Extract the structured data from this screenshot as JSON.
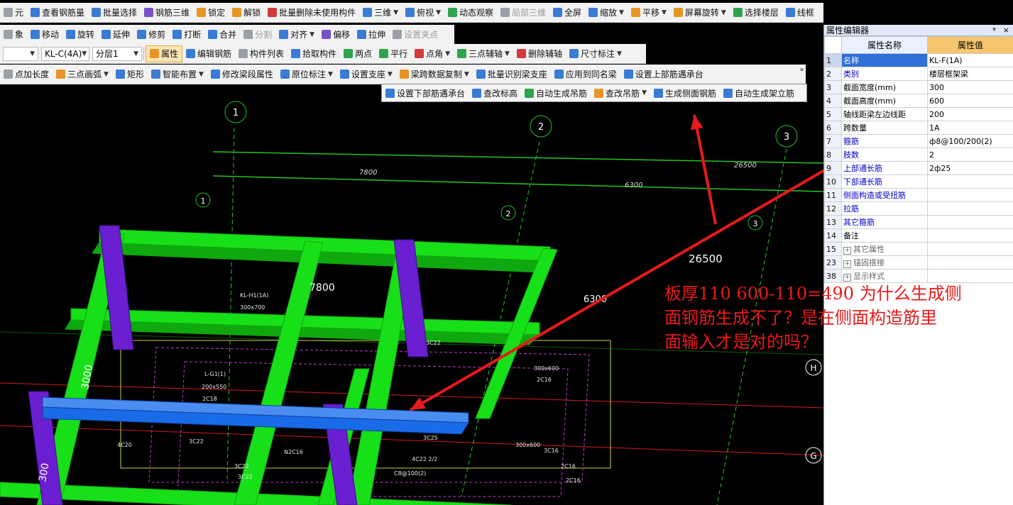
{
  "toolbar1": [
    {
      "label": "元",
      "icon": "gray"
    },
    {
      "label": "查看钢筋量",
      "icon": "blue"
    },
    {
      "label": "批量选择",
      "icon": "blue"
    },
    {
      "label": "钢筋三维",
      "icon": "purple"
    },
    {
      "label": "锁定",
      "icon": "orange"
    },
    {
      "label": "解锁",
      "icon": "orange"
    },
    {
      "label": "批量删除未使用构件",
      "icon": "red"
    },
    {
      "label": "三维",
      "icon": "blue",
      "caret": true
    },
    {
      "label": "俯视",
      "icon": "blue",
      "caret": true
    },
    {
      "label": "动态观察",
      "icon": "green"
    },
    {
      "label": "局部三维",
      "icon": "gray",
      "disabled": true
    },
    {
      "label": "全屏",
      "icon": "blue"
    },
    {
      "label": "缩放",
      "icon": "blue",
      "caret": true
    },
    {
      "label": "平移",
      "icon": "orange",
      "caret": true
    },
    {
      "label": "屏幕旋转",
      "icon": "orange",
      "caret": true
    },
    {
      "label": "选择楼层",
      "icon": "green"
    },
    {
      "label": "线框",
      "icon": "blue"
    }
  ],
  "toolbar2": [
    {
      "label": "象",
      "icon": "gray"
    },
    {
      "label": "移动",
      "icon": "blue"
    },
    {
      "label": "旋转",
      "icon": "blue"
    },
    {
      "label": "延伸",
      "icon": "blue"
    },
    {
      "label": "修剪",
      "icon": "blue"
    },
    {
      "label": "打断",
      "icon": "blue"
    },
    {
      "label": "合并",
      "icon": "blue"
    },
    {
      "label": "分割",
      "icon": "gray",
      "disabled": true
    },
    {
      "label": "对齐",
      "icon": "blue",
      "caret": true
    },
    {
      "label": "偏移",
      "icon": "purple"
    },
    {
      "label": "拉伸",
      "icon": "blue"
    },
    {
      "label": "设置夹点",
      "icon": "gray",
      "disabled": true
    }
  ],
  "toolbar3": {
    "combo_type": "",
    "combo_name": "KL-C(4A)",
    "combo_layer": "分层1",
    "items": [
      {
        "label": "属性",
        "icon": "orange",
        "active": true
      },
      {
        "label": "编辑钢筋",
        "icon": "blue"
      },
      {
        "label": "构件列表",
        "icon": "gray"
      },
      {
        "label": "拾取构件",
        "icon": "blue"
      },
      {
        "label": "两点",
        "icon": "green"
      },
      {
        "label": "平行",
        "icon": "green"
      },
      {
        "label": "点角",
        "icon": "red",
        "caret": true
      },
      {
        "label": "三点辅轴",
        "icon": "green",
        "caret": true
      },
      {
        "label": "删除辅轴",
        "icon": "red"
      },
      {
        "label": "尺寸标注",
        "icon": "blue",
        "caret": true
      }
    ]
  },
  "toolbar4": [
    {
      "label": "点加长度",
      "icon": "gray"
    },
    {
      "label": "三点画弧",
      "icon": "orange",
      "caret": true
    },
    {
      "label": "矩形",
      "icon": "blue"
    },
    {
      "label": "智能布置",
      "icon": "blue",
      "caret": true
    },
    {
      "label": "修改梁段属性",
      "icon": "blue"
    },
    {
      "label": "原位标注",
      "icon": "blue",
      "caret": true
    },
    {
      "label": "设置支座",
      "icon": "blue",
      "caret": true
    },
    {
      "label": "梁跨数据复制",
      "icon": "orange",
      "caret": true
    },
    {
      "label": "批量识别梁支座",
      "icon": "blue"
    },
    {
      "label": "应用到同名梁",
      "icon": "blue"
    },
    {
      "label": "设置上部筋遇承台",
      "icon": "blue"
    }
  ],
  "more_label": "»",
  "popup_toolbar": [
    {
      "label": "设置下部筋遇承台",
      "icon": "blue"
    },
    {
      "label": "查改标高",
      "icon": "blue"
    },
    {
      "label": "自动生成吊筋",
      "icon": "green"
    },
    {
      "label": "查改吊筋",
      "icon": "orange",
      "caret": true
    },
    {
      "label": "生成侧面钢筋",
      "icon": "blue"
    },
    {
      "label": "自动生成架立筋",
      "icon": "blue"
    }
  ],
  "panel": {
    "title": "属性编辑器",
    "pin": "ᵠ",
    "close": "×",
    "col_name": "属性名称",
    "col_value": "属性值",
    "rows": [
      {
        "num": "1",
        "name": "名称",
        "value": "KL-F(1A)",
        "style": "selected"
      },
      {
        "num": "2",
        "name": "类别",
        "value": "楼层框架梁",
        "style": "blue"
      },
      {
        "num": "3",
        "name": "截面宽度(mm)",
        "value": "300",
        "style": "black"
      },
      {
        "num": "4",
        "name": "截面高度(mm)",
        "value": "600",
        "style": "black"
      },
      {
        "num": "5",
        "name": "轴线距梁左边线距",
        "value": "200",
        "style": "black"
      },
      {
        "num": "6",
        "name": "跨数量",
        "value": "1A",
        "style": "black"
      },
      {
        "num": "7",
        "name": "箍筋",
        "value": "ф8@100/200(2)",
        "style": "blue"
      },
      {
        "num": "8",
        "name": "肢数",
        "value": "2",
        "style": "blue"
      },
      {
        "num": "9",
        "name": "上部通长筋",
        "value": "2ф25",
        "style": "blue"
      },
      {
        "num": "10",
        "name": "下部通长筋",
        "value": "",
        "style": "blue"
      },
      {
        "num": "11",
        "name": "侧面构造或受扭筋",
        "value": "",
        "style": "blue"
      },
      {
        "num": "12",
        "name": "拉筋",
        "value": "",
        "style": "blue"
      },
      {
        "num": "13",
        "name": "其它箍筋",
        "value": "",
        "style": "blue"
      },
      {
        "num": "14",
        "name": "备注",
        "value": "",
        "style": "black"
      },
      {
        "num": "15",
        "name": "其它属性",
        "value": "",
        "style": "gray",
        "expander": "+"
      },
      {
        "num": "23",
        "name": "锚固搭接",
        "value": "",
        "style": "gray",
        "expander": "+"
      },
      {
        "num": "38",
        "name": "显示样式",
        "value": "",
        "style": "gray",
        "expander": "+"
      }
    ]
  },
  "annotation": {
    "line1": "板厚110   600-110=490 为什么生成侧",
    "line2": "面钢筋生成不了？是在侧面构造筋里",
    "line3": "面输入才是对的吗？",
    "color": "#e81a1a"
  },
  "canvas": {
    "axis_labels": [
      "1",
      "2",
      "3",
      "H",
      "G"
    ],
    "dims_top": [
      "7800",
      "26500",
      "6300"
    ],
    "dims_main": [
      "7800",
      "26500",
      "6300",
      "3000",
      "300"
    ],
    "beam_labels": [
      "KL-H1(1A)",
      "300x700",
      "L-G1(1)",
      "200x550",
      "2C18",
      "3C22",
      "300x600",
      "2C16",
      "4C20",
      "4C22 2/2",
      "3C25",
      "3C22",
      "3C16",
      "3C22",
      "3C22",
      "2C16",
      "300x600",
      "N2C16",
      "C8@100(2)",
      "2C16"
    ],
    "colors": {
      "beam": "#18e018",
      "beam_dark": "#0fa80f",
      "column": "#6a1fd0",
      "selected_beam": "#1a6be8",
      "grid": "#0d8a0d",
      "axis_red": "#d21c1c",
      "arrow": "#e81a1a"
    }
  }
}
